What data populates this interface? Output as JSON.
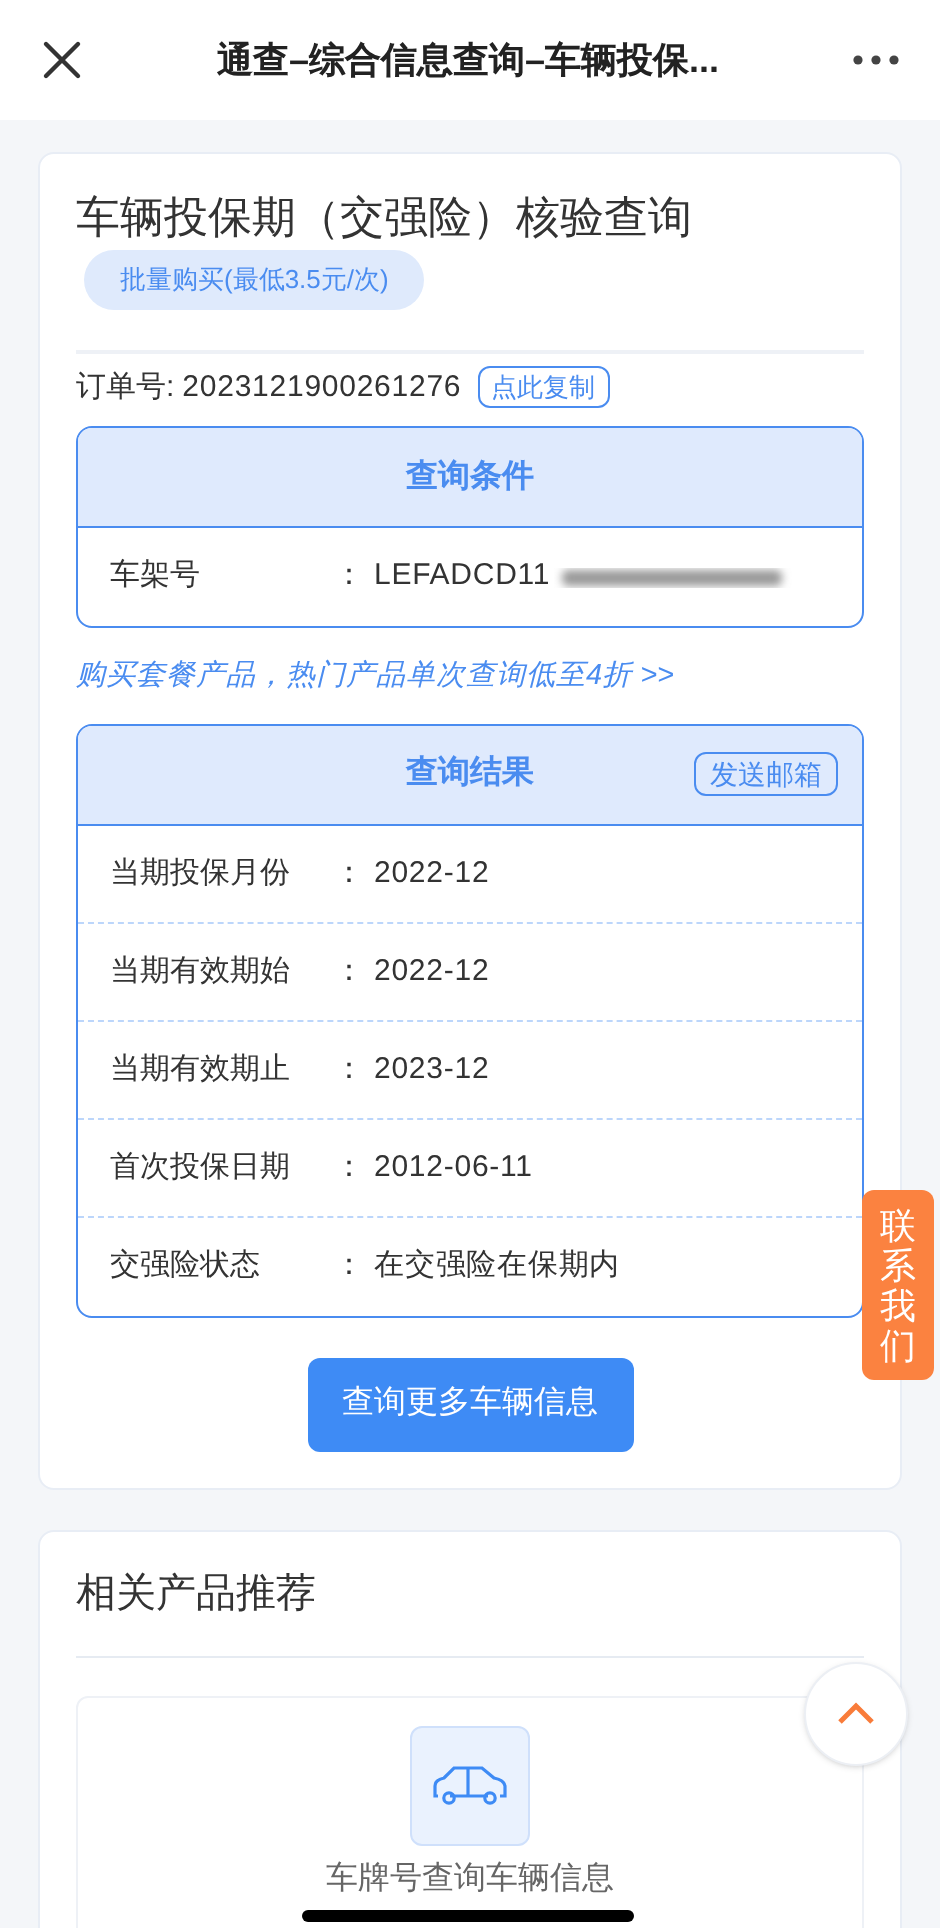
{
  "header": {
    "title": "通查–综合信息查询–车辆投保..."
  },
  "main": {
    "title": "车辆投保期（交强险）核验查询",
    "badge": "批量购买(最低3.5元/次)",
    "order_label": "订单号:",
    "order_number": "2023121900261276",
    "copy_button": "点此复制"
  },
  "conditions": {
    "title": "查询条件",
    "rows": [
      {
        "label": "车架号",
        "separator": "：",
        "value": "LEFADCD11"
      }
    ]
  },
  "promo_link": "购买套餐产品，热门产品单次查询低至4折 >>",
  "results": {
    "title": "查询结果",
    "email_button": "发送邮箱",
    "rows": [
      {
        "label": "当期投保月份",
        "separator": "：",
        "value": "2022-12"
      },
      {
        "label": "当期有效期始",
        "separator": "：",
        "value": "2022-12"
      },
      {
        "label": "当期有效期止",
        "separator": "：",
        "value": "2023-12"
      },
      {
        "label": "首次投保日期",
        "separator": "：",
        "value": "2012-06-11"
      },
      {
        "label": "交强险状态",
        "separator": "：",
        "value": "在交强险在保期内"
      }
    ]
  },
  "more_button": "查询更多车辆信息",
  "related": {
    "title": "相关产品推荐",
    "products": [
      {
        "name": "车牌号查询车辆信息"
      }
    ]
  },
  "contact_tab": "联系我们"
}
